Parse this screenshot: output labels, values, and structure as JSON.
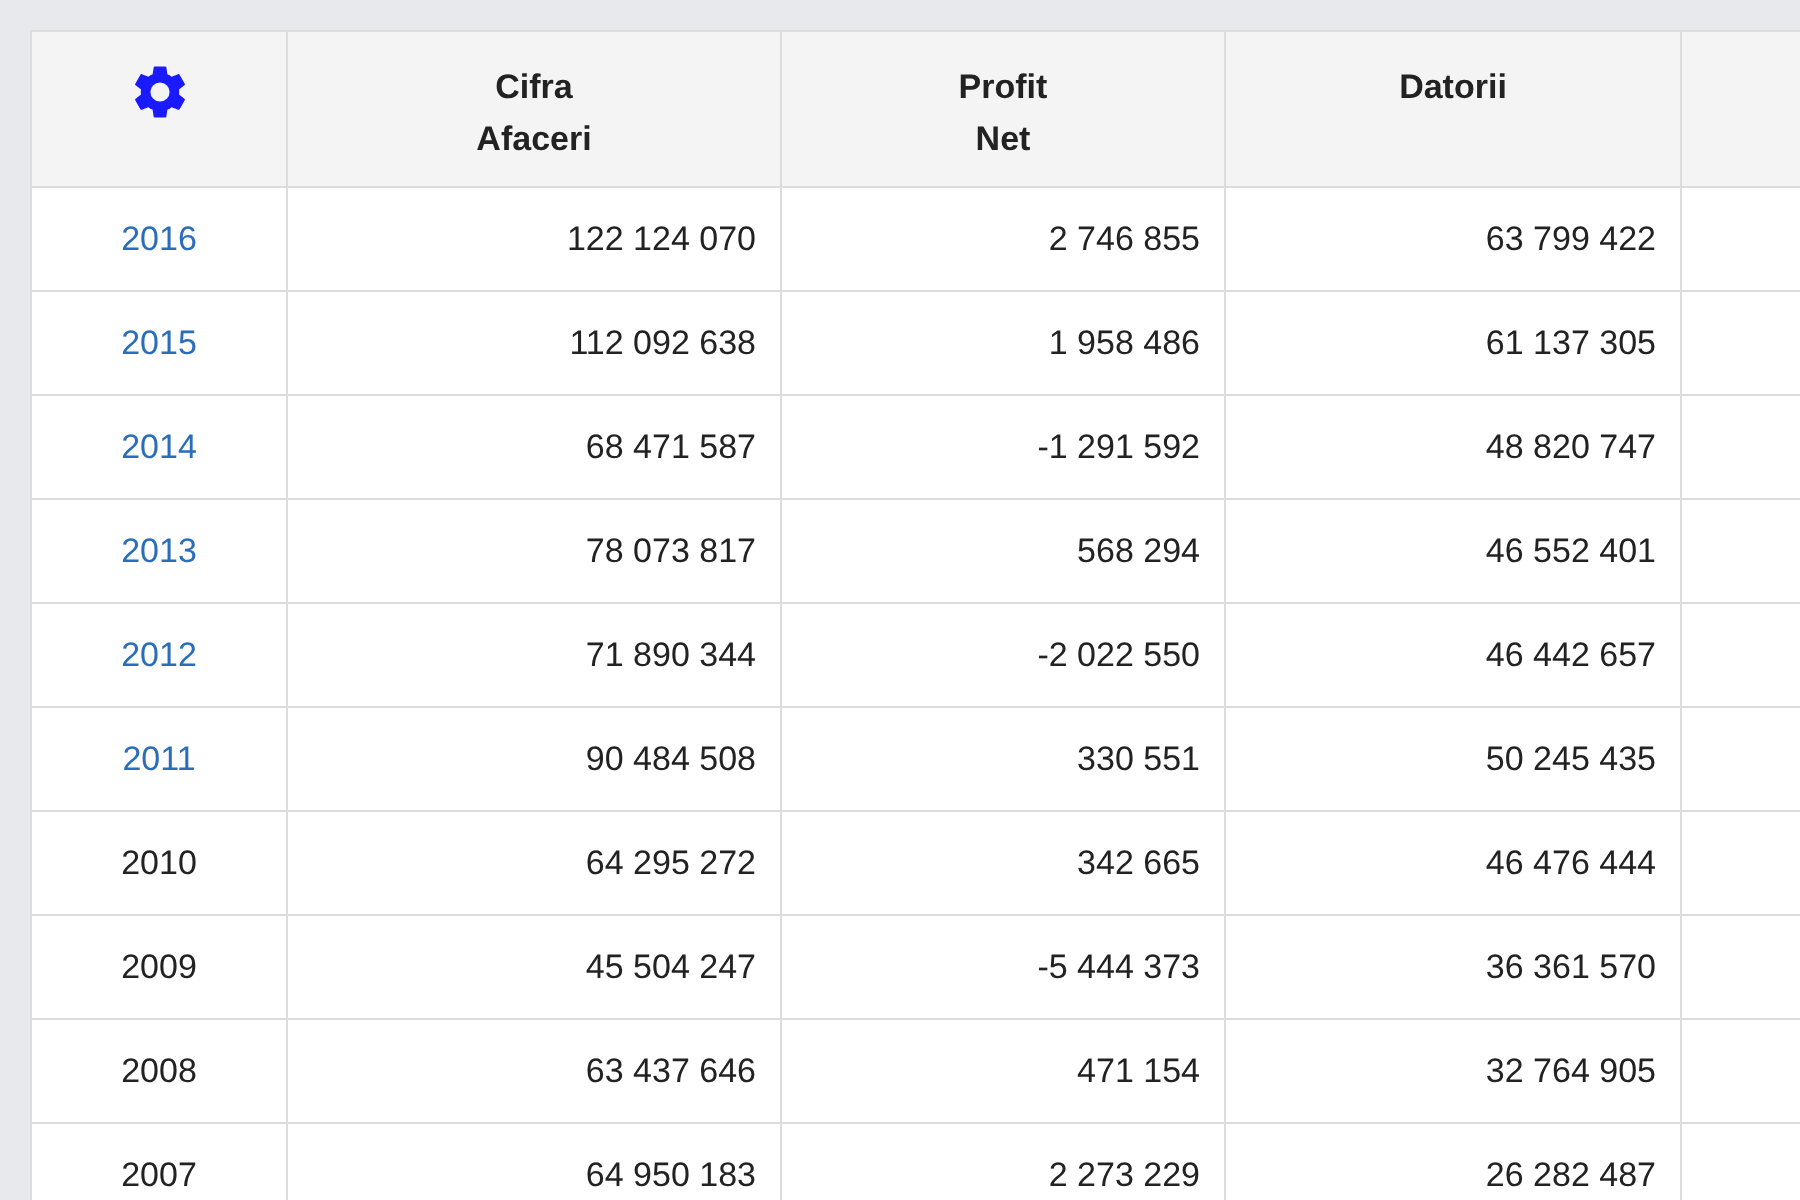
{
  "table": {
    "columns": [
      "Cifra\nAfaceri",
      "Profit\nNet",
      "Datorii"
    ],
    "rows": [
      {
        "year": "2016",
        "kind": "link",
        "values": [
          "122 124 070",
          "2 746 855",
          "63 799 422"
        ]
      },
      {
        "year": "2015",
        "kind": "link",
        "values": [
          "112 092 638",
          "1 958 486",
          "61 137 305"
        ]
      },
      {
        "year": "2014",
        "kind": "link",
        "values": [
          "68 471 587",
          "-1 291 592",
          "48 820 747"
        ]
      },
      {
        "year": "2013",
        "kind": "link",
        "values": [
          "78 073 817",
          "568 294",
          "46 552 401"
        ]
      },
      {
        "year": "2012",
        "kind": "link",
        "values": [
          "71 890 344",
          "-2 022 550",
          "46 442 657"
        ]
      },
      {
        "year": "2011",
        "kind": "link",
        "values": [
          "90 484 508",
          "330 551",
          "50 245 435"
        ]
      },
      {
        "year": "2010",
        "kind": "plain",
        "values": [
          "64 295 272",
          "342 665",
          "46 476 444"
        ]
      },
      {
        "year": "2009",
        "kind": "plain",
        "values": [
          "45 504 247",
          "-5 444 373",
          "36 361 570"
        ]
      },
      {
        "year": "2008",
        "kind": "plain",
        "values": [
          "63 437 646",
          "471 154",
          "32 764 905"
        ]
      },
      {
        "year": "2007",
        "kind": "plain",
        "values": [
          "64 950 183",
          "2 273 229",
          "26 282 487"
        ]
      }
    ]
  }
}
